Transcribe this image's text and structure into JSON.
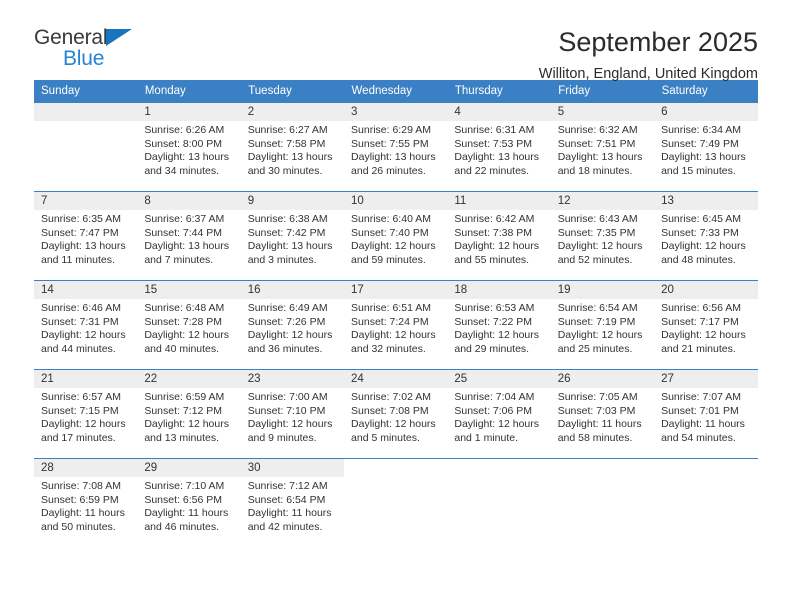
{
  "brand": {
    "name_part1": "General",
    "name_part2": "Blue",
    "accent_color": "#2585d3",
    "triangle_color": "#1a74bb"
  },
  "header": {
    "title": "September 2025",
    "location": "Williton, England, United Kingdom"
  },
  "calendar": {
    "header_bg": "#3b7fc4",
    "header_text_color": "#ffffff",
    "daynum_bg": "#eeeeee",
    "weekday_labels": [
      "Sunday",
      "Monday",
      "Tuesday",
      "Wednesday",
      "Thursday",
      "Friday",
      "Saturday"
    ],
    "weeks": [
      [
        {
          "day": "",
          "empty": true
        },
        {
          "day": "1",
          "sunrise": "Sunrise: 6:26 AM",
          "sunset": "Sunset: 8:00 PM",
          "daylight": "Daylight: 13 hours and 34 minutes."
        },
        {
          "day": "2",
          "sunrise": "Sunrise: 6:27 AM",
          "sunset": "Sunset: 7:58 PM",
          "daylight": "Daylight: 13 hours and 30 minutes."
        },
        {
          "day": "3",
          "sunrise": "Sunrise: 6:29 AM",
          "sunset": "Sunset: 7:55 PM",
          "daylight": "Daylight: 13 hours and 26 minutes."
        },
        {
          "day": "4",
          "sunrise": "Sunrise: 6:31 AM",
          "sunset": "Sunset: 7:53 PM",
          "daylight": "Daylight: 13 hours and 22 minutes."
        },
        {
          "day": "5",
          "sunrise": "Sunrise: 6:32 AM",
          "sunset": "Sunset: 7:51 PM",
          "daylight": "Daylight: 13 hours and 18 minutes."
        },
        {
          "day": "6",
          "sunrise": "Sunrise: 6:34 AM",
          "sunset": "Sunset: 7:49 PM",
          "daylight": "Daylight: 13 hours and 15 minutes."
        }
      ],
      [
        {
          "day": "7",
          "sunrise": "Sunrise: 6:35 AM",
          "sunset": "Sunset: 7:47 PM",
          "daylight": "Daylight: 13 hours and 11 minutes."
        },
        {
          "day": "8",
          "sunrise": "Sunrise: 6:37 AM",
          "sunset": "Sunset: 7:44 PM",
          "daylight": "Daylight: 13 hours and 7 minutes."
        },
        {
          "day": "9",
          "sunrise": "Sunrise: 6:38 AM",
          "sunset": "Sunset: 7:42 PM",
          "daylight": "Daylight: 13 hours and 3 minutes."
        },
        {
          "day": "10",
          "sunrise": "Sunrise: 6:40 AM",
          "sunset": "Sunset: 7:40 PM",
          "daylight": "Daylight: 12 hours and 59 minutes."
        },
        {
          "day": "11",
          "sunrise": "Sunrise: 6:42 AM",
          "sunset": "Sunset: 7:38 PM",
          "daylight": "Daylight: 12 hours and 55 minutes."
        },
        {
          "day": "12",
          "sunrise": "Sunrise: 6:43 AM",
          "sunset": "Sunset: 7:35 PM",
          "daylight": "Daylight: 12 hours and 52 minutes."
        },
        {
          "day": "13",
          "sunrise": "Sunrise: 6:45 AM",
          "sunset": "Sunset: 7:33 PM",
          "daylight": "Daylight: 12 hours and 48 minutes."
        }
      ],
      [
        {
          "day": "14",
          "sunrise": "Sunrise: 6:46 AM",
          "sunset": "Sunset: 7:31 PM",
          "daylight": "Daylight: 12 hours and 44 minutes."
        },
        {
          "day": "15",
          "sunrise": "Sunrise: 6:48 AM",
          "sunset": "Sunset: 7:28 PM",
          "daylight": "Daylight: 12 hours and 40 minutes."
        },
        {
          "day": "16",
          "sunrise": "Sunrise: 6:49 AM",
          "sunset": "Sunset: 7:26 PM",
          "daylight": "Daylight: 12 hours and 36 minutes."
        },
        {
          "day": "17",
          "sunrise": "Sunrise: 6:51 AM",
          "sunset": "Sunset: 7:24 PM",
          "daylight": "Daylight: 12 hours and 32 minutes."
        },
        {
          "day": "18",
          "sunrise": "Sunrise: 6:53 AM",
          "sunset": "Sunset: 7:22 PM",
          "daylight": "Daylight: 12 hours and 29 minutes."
        },
        {
          "day": "19",
          "sunrise": "Sunrise: 6:54 AM",
          "sunset": "Sunset: 7:19 PM",
          "daylight": "Daylight: 12 hours and 25 minutes."
        },
        {
          "day": "20",
          "sunrise": "Sunrise: 6:56 AM",
          "sunset": "Sunset: 7:17 PM",
          "daylight": "Daylight: 12 hours and 21 minutes."
        }
      ],
      [
        {
          "day": "21",
          "sunrise": "Sunrise: 6:57 AM",
          "sunset": "Sunset: 7:15 PM",
          "daylight": "Daylight: 12 hours and 17 minutes."
        },
        {
          "day": "22",
          "sunrise": "Sunrise: 6:59 AM",
          "sunset": "Sunset: 7:12 PM",
          "daylight": "Daylight: 12 hours and 13 minutes."
        },
        {
          "day": "23",
          "sunrise": "Sunrise: 7:00 AM",
          "sunset": "Sunset: 7:10 PM",
          "daylight": "Daylight: 12 hours and 9 minutes."
        },
        {
          "day": "24",
          "sunrise": "Sunrise: 7:02 AM",
          "sunset": "Sunset: 7:08 PM",
          "daylight": "Daylight: 12 hours and 5 minutes."
        },
        {
          "day": "25",
          "sunrise": "Sunrise: 7:04 AM",
          "sunset": "Sunset: 7:06 PM",
          "daylight": "Daylight: 12 hours and 1 minute."
        },
        {
          "day": "26",
          "sunrise": "Sunrise: 7:05 AM",
          "sunset": "Sunset: 7:03 PM",
          "daylight": "Daylight: 11 hours and 58 minutes."
        },
        {
          "day": "27",
          "sunrise": "Sunrise: 7:07 AM",
          "sunset": "Sunset: 7:01 PM",
          "daylight": "Daylight: 11 hours and 54 minutes."
        }
      ],
      [
        {
          "day": "28",
          "sunrise": "Sunrise: 7:08 AM",
          "sunset": "Sunset: 6:59 PM",
          "daylight": "Daylight: 11 hours and 50 minutes."
        },
        {
          "day": "29",
          "sunrise": "Sunrise: 7:10 AM",
          "sunset": "Sunset: 6:56 PM",
          "daylight": "Daylight: 11 hours and 46 minutes."
        },
        {
          "day": "30",
          "sunrise": "Sunrise: 7:12 AM",
          "sunset": "Sunset: 6:54 PM",
          "daylight": "Daylight: 11 hours and 42 minutes."
        },
        {
          "day": "",
          "empty": true
        },
        {
          "day": "",
          "empty": true
        },
        {
          "day": "",
          "empty": true
        },
        {
          "day": "",
          "empty": true
        }
      ]
    ]
  }
}
